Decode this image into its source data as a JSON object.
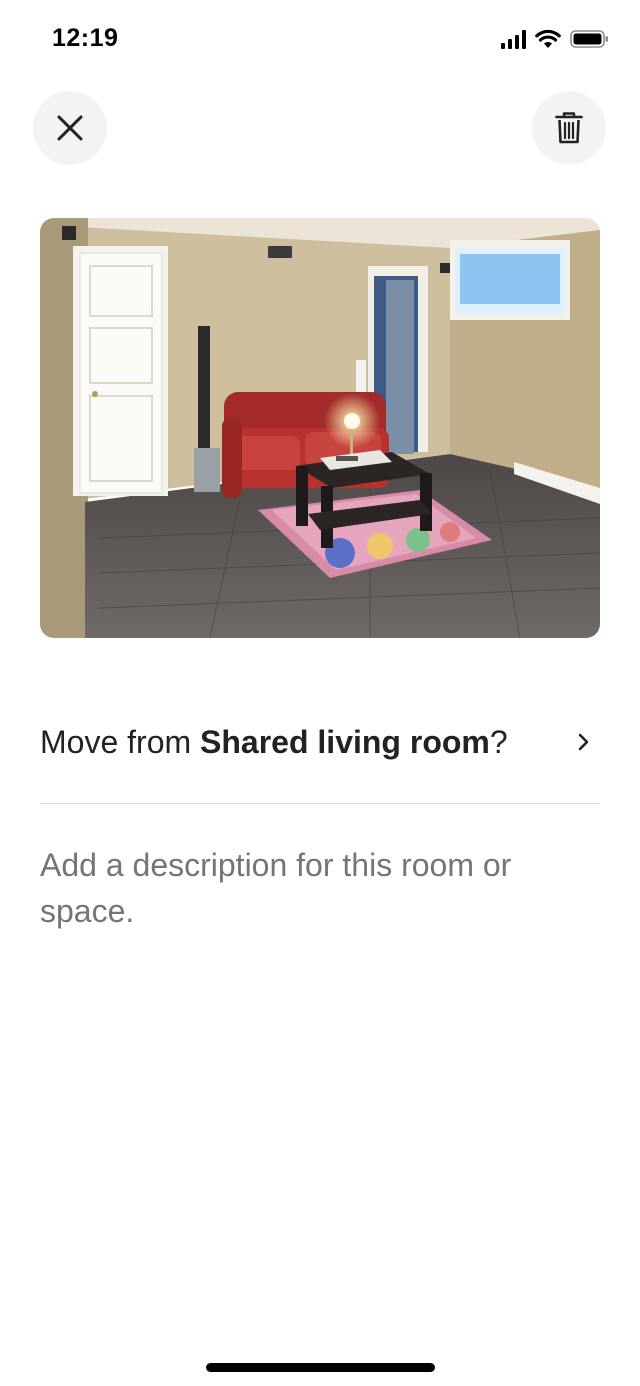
{
  "status_bar": {
    "time": "12:19"
  },
  "header": {
    "close_icon": "close-icon",
    "delete_icon": "trash-icon"
  },
  "photo": {
    "description": "room-photo"
  },
  "move_row": {
    "prefix": "Move from ",
    "room": "Shared living room",
    "suffix": "?",
    "icon": "chevron-right-icon"
  },
  "description": {
    "placeholder": "Add a description for this room or space."
  },
  "colors": {
    "text": "#222222",
    "muted": "#717171",
    "divider": "#dddddd",
    "button_bg": "#f3f3f3"
  }
}
